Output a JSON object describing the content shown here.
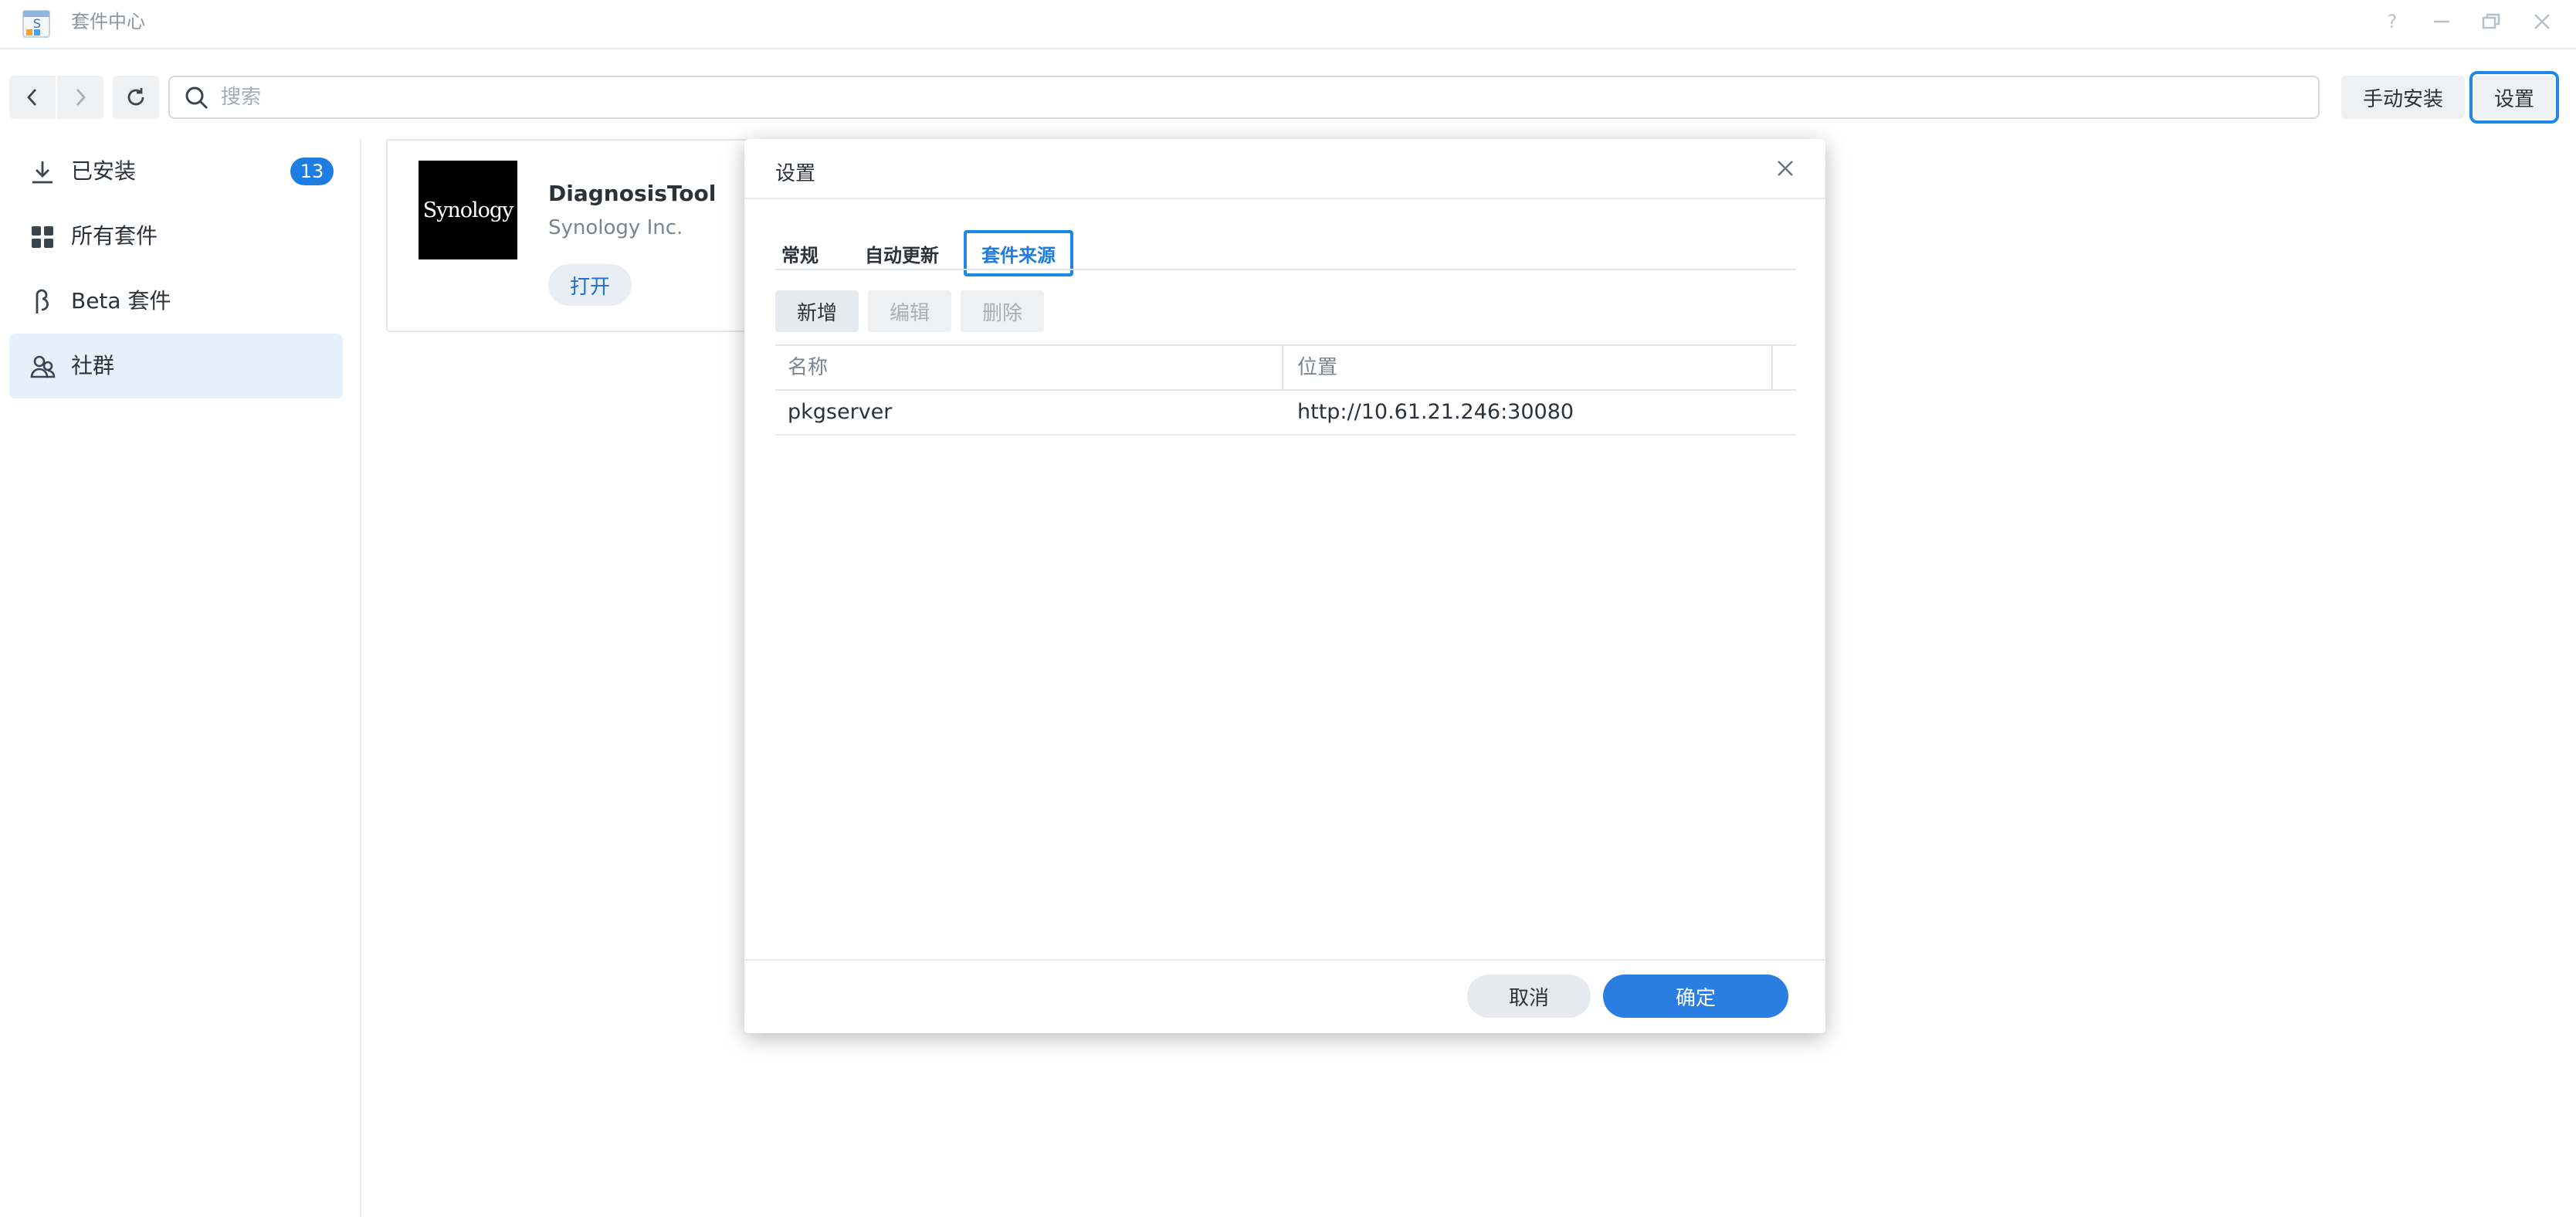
{
  "window": {
    "title": "套件中心",
    "app_icon": "package-center-icon",
    "controls": [
      "help-icon",
      "minimize-icon",
      "restore-icon",
      "close-icon"
    ]
  },
  "toolbar": {
    "search_placeholder": "搜索",
    "manual_install_label": "手动安装",
    "settings_label": "设置"
  },
  "sidebar": {
    "items": [
      {
        "label": "已安装",
        "icon": "download-icon",
        "badge": "13"
      },
      {
        "label": "所有套件",
        "icon": "grid-icon"
      },
      {
        "label": "Beta 套件",
        "icon": "beta-icon"
      },
      {
        "label": "社群",
        "icon": "community-icon",
        "active": true
      }
    ]
  },
  "package_card": {
    "logo_text": "Synology",
    "name": "DiagnosisTool",
    "vendor": "Synology Inc.",
    "open_label": "打开"
  },
  "dialog": {
    "title": "设置",
    "tabs": [
      {
        "label": "常规"
      },
      {
        "label": "自动更新"
      },
      {
        "label": "套件来源",
        "active": true
      }
    ],
    "actions": {
      "add": "新增",
      "edit": "编辑",
      "delete": "删除"
    },
    "table": {
      "columns": [
        "名称",
        "位置"
      ],
      "rows": [
        {
          "name": "pkgserver",
          "location": "http://10.61.21.246:30080"
        }
      ]
    },
    "cancel_label": "取消",
    "ok_label": "确定"
  },
  "colors": {
    "accent": "#1f7ce0",
    "selection_outline": "#1e88e5",
    "active_sidebar_bg": "#e6f0fa",
    "primary_button": "#2a7de1"
  }
}
